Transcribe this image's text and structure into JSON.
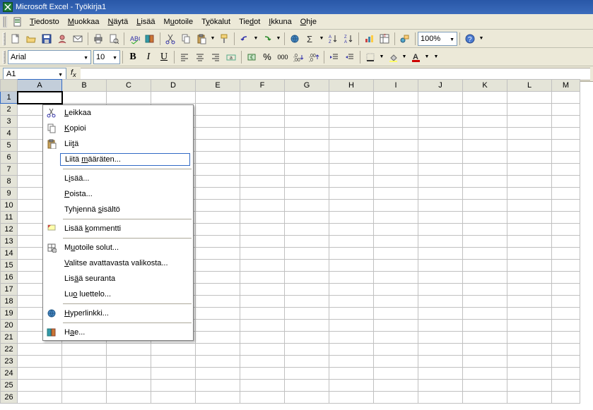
{
  "title": "Microsoft Excel - Työkirja1",
  "menu": {
    "tiedosto": "Tiedosto",
    "muokkaa": "Muokkaa",
    "nayta": "Näytä",
    "lisaa": "Lisää",
    "muotoile": "Muotoile",
    "tyokalut": "Työkalut",
    "tiedot": "Tiedot",
    "ikkuna": "Ikkuna",
    "ohje": "Ohje"
  },
  "toolbar1": {
    "zoom": "100%"
  },
  "toolbar2": {
    "font": "Arial",
    "size": "10",
    "bold": "B",
    "italic": "I",
    "underline": "U",
    "currency": "€",
    "percent": "%",
    "thousands": "000"
  },
  "namebox": {
    "cell": "A1"
  },
  "formula": {
    "value": ""
  },
  "columns": [
    "A",
    "B",
    "C",
    "D",
    "E",
    "F",
    "G",
    "H",
    "I",
    "J",
    "K",
    "L",
    "M"
  ],
  "rows": [
    "1",
    "2",
    "3",
    "4",
    "5",
    "6",
    "7",
    "8",
    "9",
    "10",
    "11",
    "12",
    "13",
    "14",
    "15",
    "16",
    "17",
    "18",
    "19",
    "20",
    "21",
    "22",
    "23",
    "24",
    "25",
    "26"
  ],
  "selected": {
    "col": "A",
    "row": "1"
  },
  "context_menu": {
    "cut": "Leikkaa",
    "copy": "Kopioi",
    "paste": "Liitä",
    "paste_special": "Liitä määräten...",
    "insert": "Lisää...",
    "delete": "Poista...",
    "clear": "Tyhjennä sisältö",
    "insert_comment": "Lisää kommentti",
    "format_cells": "Muotoile solut...",
    "pick_list": "Valitse avattavasta valikosta...",
    "add_watch": "Lisää seuranta",
    "create_list": "Luo luettelo...",
    "hyperlink": "Hyperlinkki...",
    "lookup": "Hae..."
  }
}
